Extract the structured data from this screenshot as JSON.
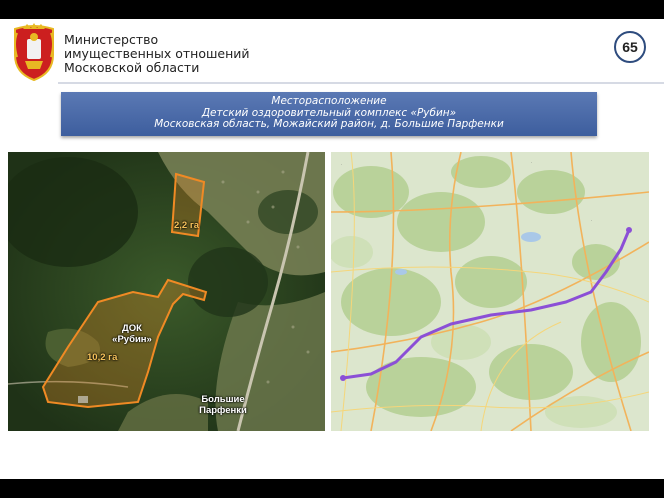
{
  "header": {
    "ministry_lines": [
      "Министерство",
      "имущественных отношений",
      "Московской области"
    ],
    "page_number": "65"
  },
  "banner": {
    "lines": [
      "Месторасположение",
      "Детский оздоровительный комплекс «Рубин»",
      "Московская область, Можайский район, д. Большие Парфенки"
    ]
  },
  "satellite": {
    "plot_small_area": "2,2 га",
    "plot_large_name_line1": "ДОК",
    "plot_large_name_line2": "«Рубин»",
    "plot_large_area": "10,2 га",
    "village_line1": "Большие",
    "village_line2": "Парфенки"
  },
  "colors": {
    "banner": "#4a6aa8",
    "plot_outline": "#f08a24",
    "route": "#8b4fd6",
    "page_circle": "#2e4c7e"
  }
}
